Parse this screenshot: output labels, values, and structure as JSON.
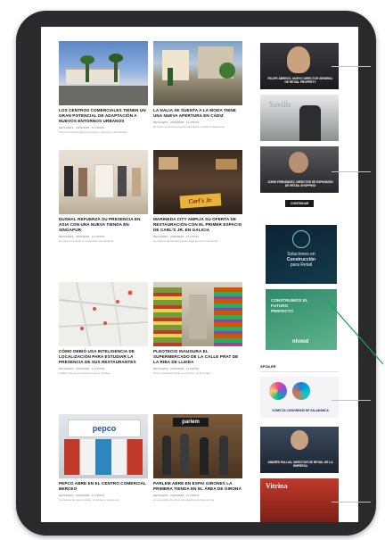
{
  "articles": [
    {
      "title": "Los centros comerciales tienen un gran potencial de adaptación a nuevos entornos urbanos",
      "meta": "RETAILERS · 20/02/2025 · 11 VISTAS",
      "excerpt": "Tiene el Consejo Mayor Ecológico, Accesos y Actividades"
    },
    {
      "title": "La Nalia se suenta a la moda tiene una nueva apertura en Cádiz",
      "meta": "RETAILERS · 20/02/2025 · 11 VISTAS",
      "excerpt": "El centro comercial presenta al público nuevas instalaciones"
    },
    {
      "title": "Dushal refuerza su presencia en Asia con una nueva tienda en Singapur",
      "meta": "RETAILERS · 20/02/2025 · 11 VISTAS",
      "excerpt": "La marca continúa su expansión internacional"
    },
    {
      "title": "Marineda City amplía su oferta de restauración con el primer espacio de Carl's Jr. en Galicia",
      "meta": "RETAILERS · 20/02/2025 · 11 VISTAS",
      "excerpt": "La cadena de hamburguesas llega al centro comercial"
    },
    {
      "title": "Cómo debió usa inteligencia de localización para estudiar la presencia de sus restaurantes",
      "meta": "RETAILERS · 20/02/2025 · 11 VISTAS",
      "excerpt": "Análisis del comportamiento de los clientes"
    },
    {
      "title": "Pleotecio inaugura el supermercado de la calle Prat de la Riba de Lleida",
      "meta": "RETAILERS · 20/02/2025 · 11 VISTAS",
      "excerpt": "Nuevo establecimiento en el centro de la ciudad"
    },
    {
      "title": "Pepco abre en el centro comercial Berceo",
      "meta": "RETAILERS · 20/02/2025 · 11 VISTAS",
      "excerpt": "La cadena de origen polaco continúa su expansión"
    },
    {
      "title": "Parlem abre en Espai Girones la primera tienda en el área de Girona",
      "meta": "RETAILERS · 20/02/2025 · 11 VISTAS",
      "excerpt": "La operadora de telecomunicaciones amplía su red"
    }
  ],
  "sidebar": {
    "tag_button": "CONTINUAR",
    "section_label": "SPOILER",
    "items": [
      {
        "caption": "Felipe Ábrego, nuevo director general de Retail Property"
      },
      {
        "caption": "Savills"
      },
      {
        "caption": "Jordi Fernández, director de expansión de Retail Shopping"
      },
      {
        "caption": "Conecta Coworking de Salamanca"
      },
      {
        "caption": "Andrés Pallas, director de retail de la empresa"
      },
      {
        "caption": "Vitrina"
      }
    ],
    "ad1": {
      "line1": "Soluciones en",
      "line2": "Construcción",
      "line3": "para Retail"
    },
    "ad2": {
      "line1": "CONSTRUIMOS EL",
      "line2": "FUTURO",
      "line3": "PERFECTO",
      "brand": "nhood"
    }
  },
  "thumb_labels": {
    "carls": "Carl's Jr.",
    "pepco": "pepco",
    "parlem": "parlem"
  }
}
